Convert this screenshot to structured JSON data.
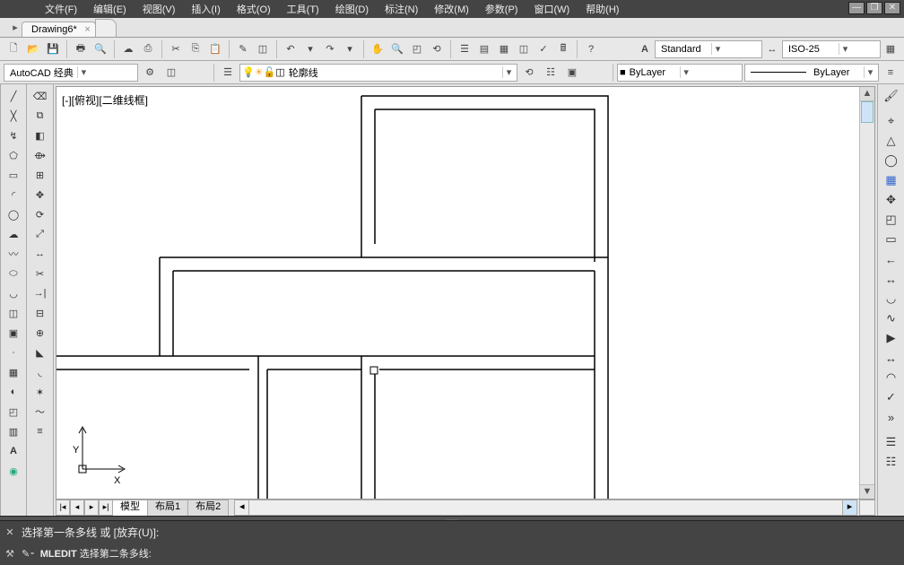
{
  "menu": {
    "items": [
      "文件(F)",
      "编辑(E)",
      "视图(V)",
      "插入(I)",
      "格式(O)",
      "工具(T)",
      "绘图(D)",
      "标注(N)",
      "修改(M)",
      "参数(P)",
      "窗口(W)",
      "帮助(H)"
    ]
  },
  "tabs": {
    "active": "Drawing6*"
  },
  "toolbar2": {
    "workspace_label": "AutoCAD 经典",
    "layer_label": "轮廓线"
  },
  "props": {
    "style_label": "Standard",
    "dim_label": "ISO-25",
    "bylayer1": "ByLayer",
    "bylayer2": "ByLayer"
  },
  "canvas": {
    "view_label": "[-][俯视][二维线框]",
    "ucs_y": "Y",
    "ucs_x": "X"
  },
  "bottom_tabs": {
    "model": "模型",
    "layout1": "布局1",
    "layout2": "布局2"
  },
  "cmd": {
    "line1": "选择第一条多线 或  [放弃(U)]:",
    "line2_cmd": "MLEDIT",
    "line2_rest": " 选择第二条多线:"
  }
}
